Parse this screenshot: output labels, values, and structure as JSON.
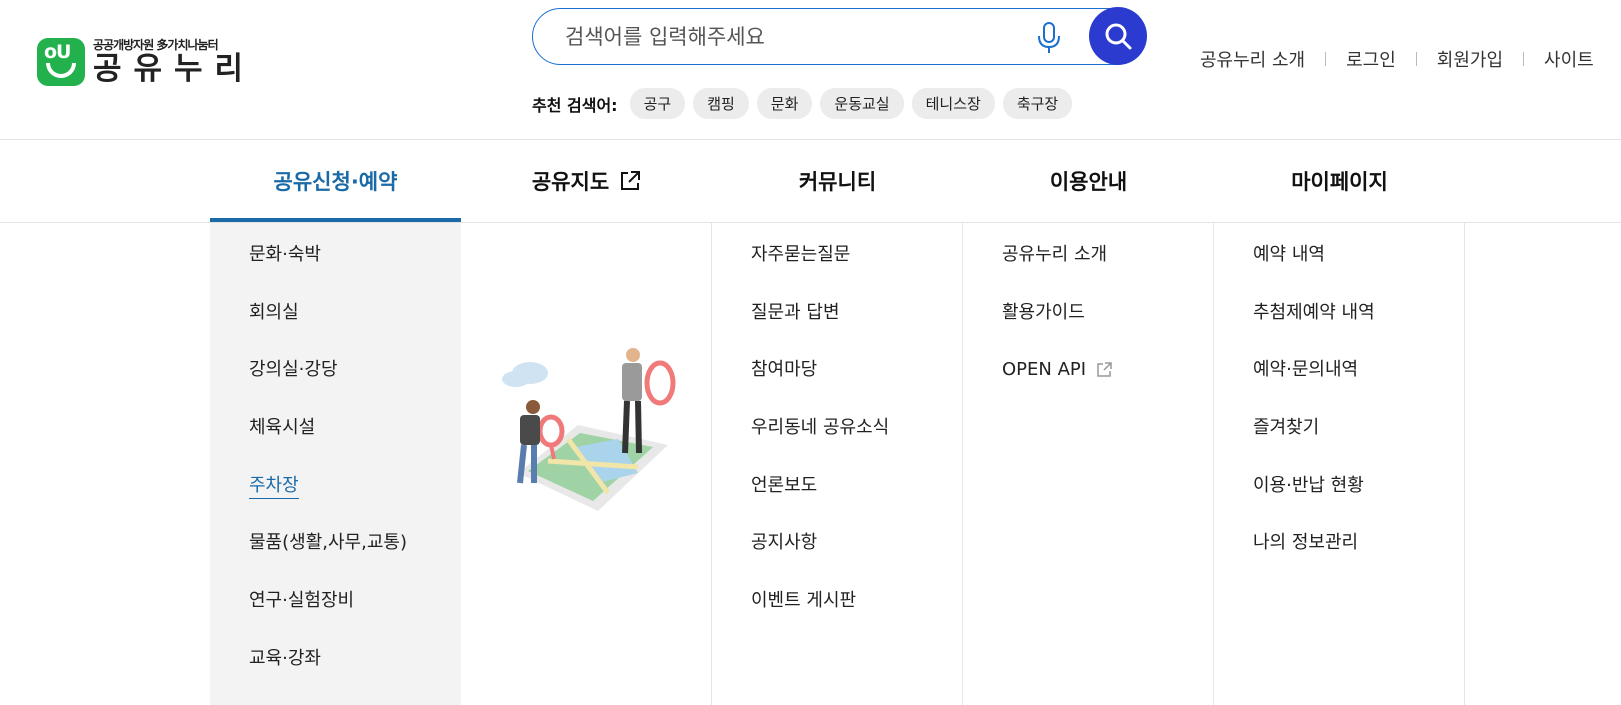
{
  "logo": {
    "subtitle": "공공개방자원 多가치나눔터",
    "name": "공유누리",
    "mark_text": "oU"
  },
  "search": {
    "placeholder": "검색어를 입력해주세요"
  },
  "recommended": {
    "label": "추천 검색어:",
    "chips": [
      "공구",
      "캠핑",
      "문화",
      "운동교실",
      "테니스장",
      "축구장"
    ]
  },
  "util_links": [
    "공유누리 소개",
    "로그인",
    "회원가입",
    "사이트"
  ],
  "nav": [
    {
      "label": "공유신청·예약",
      "active": true
    },
    {
      "label": "공유지도",
      "external": true
    },
    {
      "label": "커뮤니티"
    },
    {
      "label": "이용안내"
    },
    {
      "label": "마이페이지"
    }
  ],
  "menu": {
    "share": [
      "문화·숙박",
      "회의실",
      "강의실·강당",
      "체육시설",
      "주차장",
      "물품(생활,사무,교통)",
      "연구·실험장비",
      "교육·강좌"
    ],
    "share_active": "주차장",
    "community": [
      "자주묻는질문",
      "질문과 답변",
      "참여마당",
      "우리동네 공유소식",
      "언론보도",
      "공지사항",
      "이벤트 게시판"
    ],
    "guide": [
      "공유누리 소개",
      "활용가이드",
      "OPEN API"
    ],
    "mypage": [
      "예약 내역",
      "추첨제예약 내역",
      "예약·문의내역",
      "즐겨찾기",
      "이용·반납 현황",
      "나의 정보관리"
    ]
  },
  "colors": {
    "accent": "#1a6aa8",
    "search_button": "#2b3bd0",
    "logo_green": "#22b14c"
  }
}
